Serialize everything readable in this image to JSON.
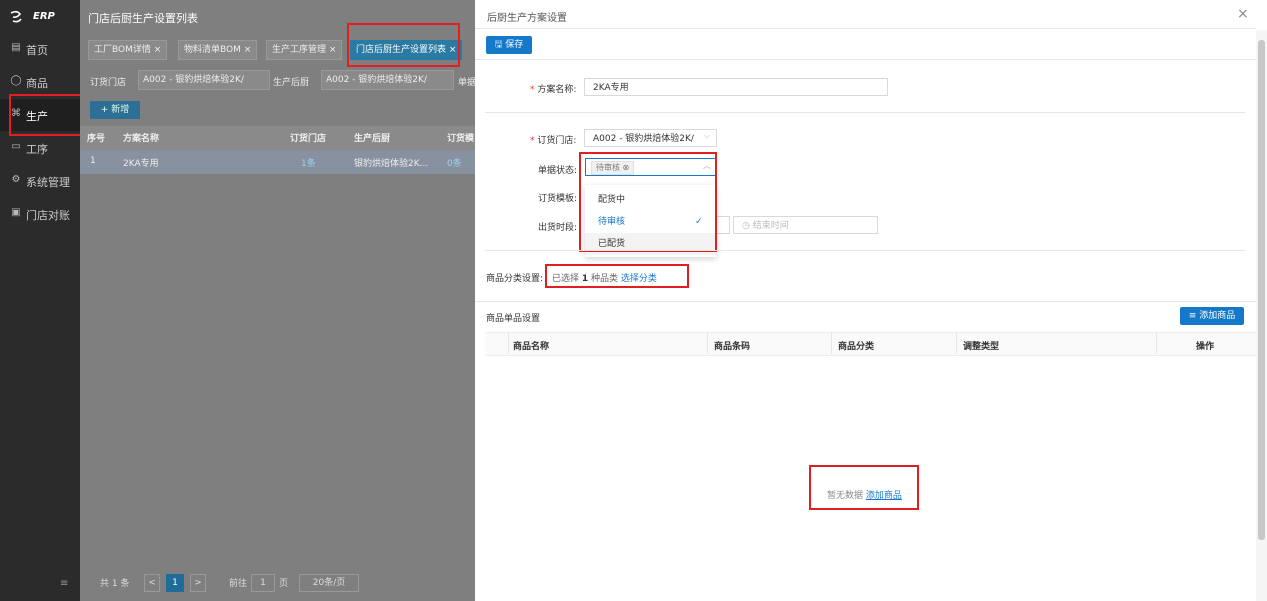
{
  "sidebar": {
    "logo_text": "ERP",
    "items": [
      {
        "label": "首页",
        "icon": "home-icon"
      },
      {
        "label": "商品",
        "icon": "goods-icon"
      },
      {
        "label": "生产",
        "icon": "production-icon"
      },
      {
        "label": "工序",
        "icon": "process-icon"
      },
      {
        "label": "系统管理",
        "icon": "settings-icon"
      },
      {
        "label": "门店对账",
        "icon": "reconcile-icon"
      }
    ],
    "collapse_icon": "≡"
  },
  "main": {
    "title": "门店后厨生产设置列表",
    "tabs": [
      {
        "label": "工厂BOM详情 ×"
      },
      {
        "label": "物料清单BOM ×"
      },
      {
        "label": "生产工序管理 ×"
      },
      {
        "label": "门店后厨生产设置列表 ×"
      }
    ],
    "filters": {
      "store_label": "订货门店",
      "store_value": "A002 - 银豹烘焙体验2K∕",
      "kitchen_label": "生产后厨",
      "kitchen_value": "A002 - 银豹烘焙体验2K∕",
      "extra_label": "单据"
    },
    "add_button": "+ 新增",
    "table": {
      "headers": [
        "序号",
        "方案名称",
        "订货门店",
        "生产后厨",
        "订货模"
      ],
      "rows": [
        [
          "1",
          "2KA专用",
          "1条",
          "银豹烘焙体验2K...",
          "0条"
        ]
      ]
    },
    "pager": {
      "total": "共 1 条",
      "prev": "<",
      "page": "1",
      "next": ">",
      "goto_label": "前往",
      "goto_value": "1",
      "page_unit": "页",
      "page_size": "20条/页"
    }
  },
  "drawer": {
    "title": "后厨生产方案设置",
    "close": "×",
    "save_button": "保存",
    "form": {
      "plan_name_label": "方案名称:",
      "plan_name_value": "2KA专用",
      "store_label": "订货门店:",
      "store_value": "A002 - 银豹烘焙体验2K∕",
      "status_label": "单据状态:",
      "status_tag": "待审核",
      "template_label": "订货模板:",
      "time_label": "出货时段:",
      "end_time_placeholder": "结束时间"
    },
    "status_options": [
      {
        "label": "配货中",
        "selected": false
      },
      {
        "label": "待审核",
        "selected": true
      },
      {
        "label": "已配货",
        "selected": false
      }
    ],
    "category": {
      "label": "商品分类设置:",
      "prefix": "已选择",
      "count": "1",
      "suffix": "种品类",
      "link": "选择分类"
    },
    "items_section": {
      "title": "商品单品设置",
      "add_button": "添加商品",
      "headers": [
        "商品名称",
        "商品条码",
        "商品分类",
        "调整类型",
        "操作"
      ],
      "empty_text": "暂无数据",
      "empty_link": "添加商品"
    }
  },
  "colors": {
    "primary": "#1678c9",
    "sidebar_bg": "#2b2b2b",
    "highlight": "#e02020"
  }
}
